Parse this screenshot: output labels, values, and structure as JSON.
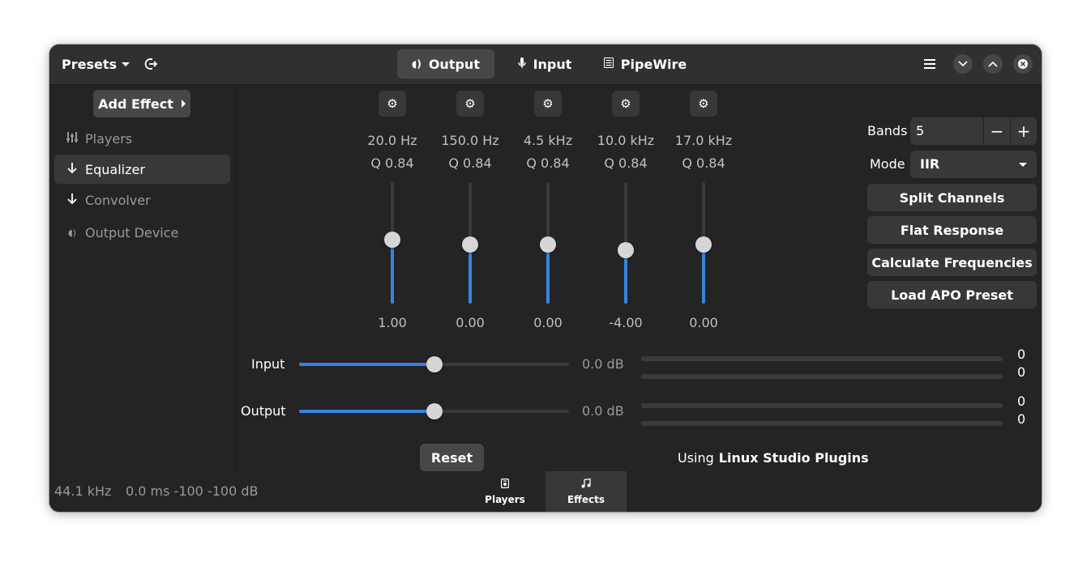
{
  "header": {
    "presets_label": "Presets",
    "tabs": [
      {
        "label": "Output",
        "icon": "speaker-icon"
      },
      {
        "label": "Input",
        "icon": "microphone-icon"
      },
      {
        "label": "PipeWire",
        "icon": "pipewire-icon"
      }
    ]
  },
  "sidebar": {
    "add_effect_label": "Add Effect",
    "items": [
      {
        "label": "Players",
        "icon": "players-icon"
      },
      {
        "label": "Equalizer",
        "icon": "arrow-down-icon"
      },
      {
        "label": "Convolver",
        "icon": "arrow-down-icon"
      },
      {
        "label": "Output Device",
        "icon": "speaker-icon"
      }
    ]
  },
  "equalizer": {
    "bands": [
      {
        "freq": "20.0 Hz",
        "q": "Q 0.84",
        "value": "1.00",
        "level": 0.53
      },
      {
        "freq": "150.0 Hz",
        "q": "Q 0.84",
        "value": "0.00",
        "level": 0.49
      },
      {
        "freq": "4.5 kHz",
        "q": "Q 0.84",
        "value": "0.00",
        "level": 0.49
      },
      {
        "freq": "10.0 kHz",
        "q": "Q 0.84",
        "value": "-4.00",
        "level": 0.44
      },
      {
        "freq": "17.0 kHz",
        "q": "Q 0.84",
        "value": "0.00",
        "level": 0.49
      }
    ],
    "bands_label": "Bands",
    "bands_value": "5",
    "mode_label": "Mode",
    "mode_value": "IIR",
    "buttons": [
      "Split Channels",
      "Flat Response",
      "Calculate Frequencies",
      "Load APO Preset"
    ],
    "input_label": "Input",
    "input_gain": "0.0 dB",
    "input_level": 0.5,
    "output_label": "Output",
    "output_gain": "0.0 dB",
    "output_level": 0.5,
    "meters": [
      "0",
      "0",
      "0",
      "0"
    ],
    "reset_label": "Reset",
    "using_label": "Using",
    "plugin_name": "Linux Studio Plugins"
  },
  "statusbar": {
    "sample_rate": "44.1 kHz",
    "latency": "0.0 ms -100 -100 dB",
    "view_tabs": [
      {
        "label": "Players",
        "icon": "players-icon"
      },
      {
        "label": "Effects",
        "icon": "music-note-icon"
      }
    ]
  },
  "colors": {
    "accent": "#3584e4",
    "background": "#242424",
    "headerbar": "#303030"
  }
}
